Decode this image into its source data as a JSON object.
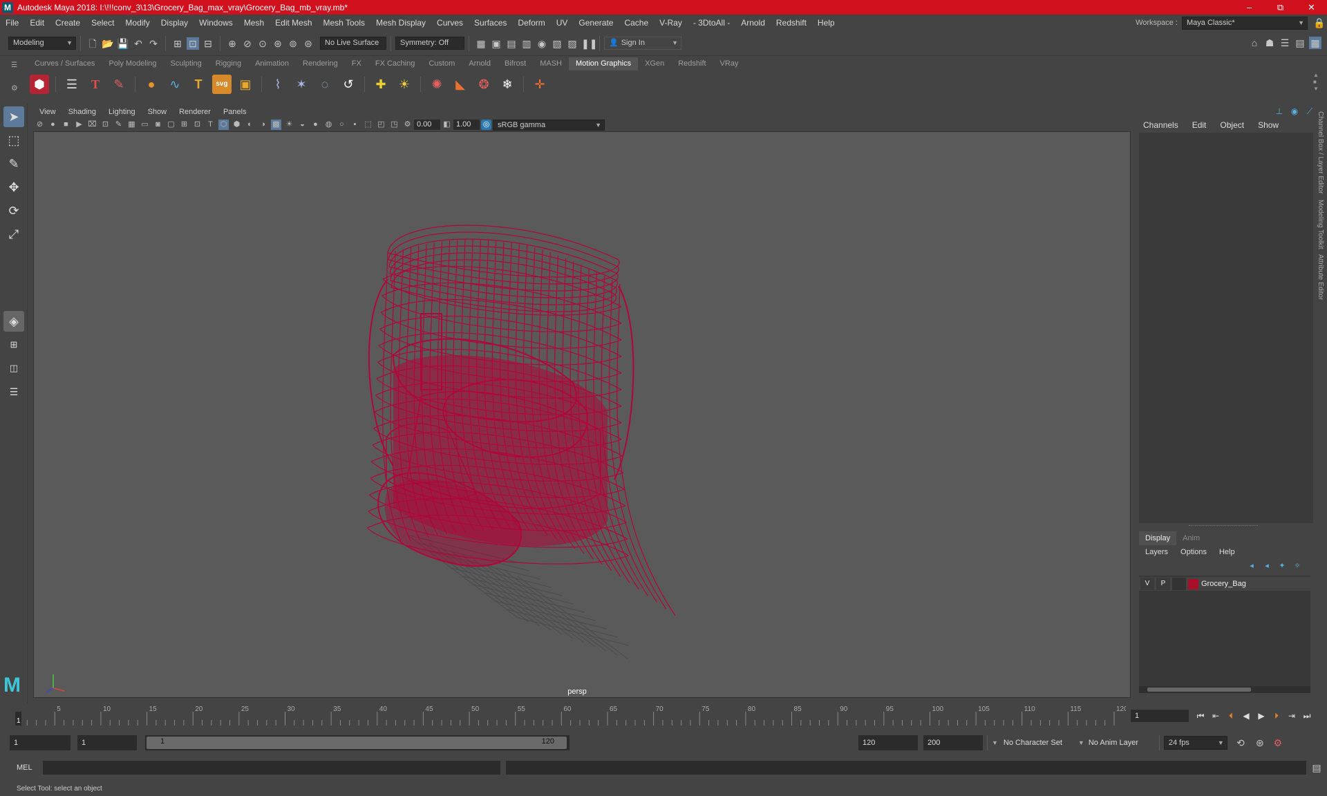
{
  "window": {
    "title": "Autodesk Maya 2018: I:\\!!!conv_3\\13\\Grocery_Bag_max_vray\\Grocery_Bag_mb_vray.mb*",
    "logo": "M",
    "minimize": "–",
    "restore": "⧉",
    "close": "✕"
  },
  "menubar": {
    "items": [
      "File",
      "Edit",
      "Create",
      "Select",
      "Modify",
      "Display",
      "Windows",
      "Mesh",
      "Edit Mesh",
      "Mesh Tools",
      "Mesh Display",
      "Curves",
      "Surfaces",
      "Deform",
      "UV",
      "Generate",
      "Cache",
      "V-Ray",
      "- 3DtoAll -",
      "Arnold",
      "Redshift",
      "Help"
    ],
    "workspace_label": "Workspace :",
    "workspace_value": "Maya Classic*"
  },
  "statusline": {
    "mode": "Modeling",
    "live_surface": "No Live Surface",
    "symmetry": "Symmetry: Off",
    "sign_in": "Sign In"
  },
  "shelf": {
    "tabs": [
      "Curves / Surfaces",
      "Poly Modeling",
      "Sculpting",
      "Rigging",
      "Animation",
      "Rendering",
      "FX",
      "FX Caching",
      "Custom",
      "Arnold",
      "Bifrost",
      "MASH",
      "Motion Graphics",
      "XGen",
      "Redshift",
      "VRay"
    ],
    "active_tab": "Motion Graphics",
    "text_icon": "T",
    "svg_icon": "svg"
  },
  "viewport": {
    "menu": [
      "View",
      "Shading",
      "Lighting",
      "Show",
      "Renderer",
      "Panels"
    ],
    "exposure": "0.00",
    "gamma": "1.00",
    "color_space": "sRGB gamma",
    "camera": "persp",
    "wire_color": "#b0073a"
  },
  "channelbox": {
    "menu": [
      "Channels",
      "Edit",
      "Object",
      "Show"
    ],
    "side_tabs": [
      "Channel Box / Layer Editor",
      "Modeling Toolkit",
      "Attribute Editor"
    ]
  },
  "layers": {
    "tabs": [
      "Display",
      "Anim"
    ],
    "menu": [
      "Layers",
      "Options",
      "Help"
    ],
    "items": [
      {
        "v": "V",
        "p": "P",
        "color": "#a8102a",
        "name": "Grocery_Bag"
      }
    ]
  },
  "timeline": {
    "ticks": [
      "1",
      "5",
      "10",
      "15",
      "20",
      "25",
      "30",
      "35",
      "40",
      "45",
      "50",
      "55",
      "60",
      "65",
      "70",
      "75",
      "80",
      "85",
      "90",
      "95",
      "100",
      "105",
      "110",
      "115",
      "120"
    ],
    "current_frame": "1"
  },
  "range": {
    "start": "1",
    "playback_start": "1",
    "slider_start": "1",
    "slider_end": "120",
    "playback_end": "120",
    "end": "200",
    "character_set": "No Character Set",
    "anim_layer": "No Anim Layer",
    "fps": "24 fps"
  },
  "commandline": {
    "label": "MEL"
  },
  "helpline": {
    "text": "Select Tool: select an object"
  }
}
